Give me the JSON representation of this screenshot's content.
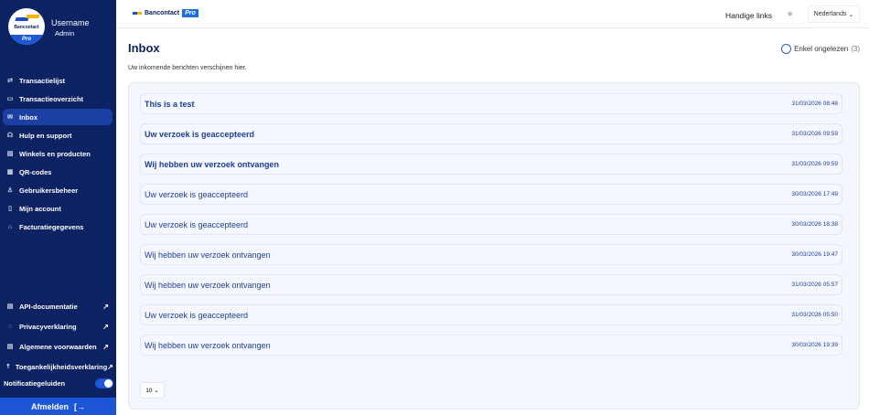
{
  "sidebar": {
    "username": "Username",
    "role": "Admin",
    "logo_text": "Bancontact",
    "logo_badge": "Pro",
    "items": [
      {
        "label": "Transactielijst",
        "icon": "⇄"
      },
      {
        "label": "Transactieoverzicht",
        "icon": "▭"
      },
      {
        "label": "Inbox",
        "icon": "✉"
      },
      {
        "label": "Hulp en support",
        "icon": "☊"
      },
      {
        "label": "Winkels en producten",
        "icon": "▤"
      },
      {
        "label": "QR-codes",
        "icon": "▦"
      },
      {
        "label": "Gebruikersbeheer",
        "icon": "♙"
      },
      {
        "label": "Mijn account",
        "icon": "▯"
      },
      {
        "label": "Facturatiegegevens",
        "icon": "⌂"
      }
    ],
    "bottom": [
      {
        "label": "API-documentatie",
        "icon": "▤"
      },
      {
        "label": "Privacyverklaring",
        "icon": "◌"
      },
      {
        "label": "Algemene voorwaarden",
        "icon": "▤"
      },
      {
        "label": "Toegankelijkheidsverklaring",
        "icon": "☨"
      }
    ],
    "notif_label": "Notificatiegeluiden",
    "logout": "Afmelden"
  },
  "topbar": {
    "brand": "Bancontact",
    "brand_badge": "Pro",
    "handy_links": "Handige links",
    "language": "Nederlands"
  },
  "main": {
    "title": "Inbox",
    "subtitle": "Uw inkomende berichten verschijnen hier.",
    "filter_label": "Enkel ongelezen",
    "filter_count": "(3)",
    "page_size": "10",
    "messages": [
      {
        "title": "This is a test",
        "date": "31/03/2026 08:48",
        "unread": true
      },
      {
        "title": "Uw verzoek is geaccepteerd",
        "date": "31/03/2026 09:59",
        "unread": true
      },
      {
        "title": "Wij hebben uw verzoek ontvangen",
        "date": "31/03/2026 09:59",
        "unread": true
      },
      {
        "title": "Uw verzoek is geaccepteerd",
        "date": "30/03/2026 17:49",
        "unread": false
      },
      {
        "title": "Uw verzoek is geaccepteerd",
        "date": "30/03/2026 18:38",
        "unread": false
      },
      {
        "title": "Wij hebben uw verzoek ontvangen",
        "date": "30/03/2026 19:47",
        "unread": false
      },
      {
        "title": "Wij hebben uw verzoek ontvangen",
        "date": "31/03/2026 05:57",
        "unread": false
      },
      {
        "title": "Uw verzoek is geaccepteerd",
        "date": "31/03/2026 05:50",
        "unread": false
      },
      {
        "title": "Wij hebben uw verzoek ontvangen",
        "date": "30/03/2026 19:39",
        "unread": false
      }
    ]
  }
}
